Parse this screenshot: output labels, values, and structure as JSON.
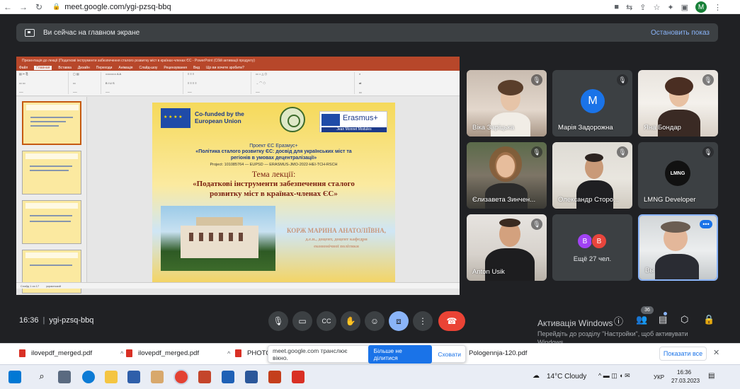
{
  "browser": {
    "url": "meet.google.com/ygi-pzsq-bbq",
    "profile_letter": "M"
  },
  "banner": {
    "text": "Ви сейчас на главном экране",
    "stop_label": "Остановить показ"
  },
  "ppt": {
    "title": "Презентація до лекції (Податкові інструменти забезпечення сталого розвитку міст в країнах-членах ЄС - PowerPoint (Сбій активації продукту)",
    "menu": [
      "Файл",
      "Главная",
      "Вставка",
      "Дизайн",
      "Переходи",
      "Анімація",
      "Слайд-шоу",
      "Рецензування",
      "Вид",
      "Що ви хочете зробити?"
    ],
    "status_left": "Слайд 1 из 17",
    "status_lang": "украинский"
  },
  "slide": {
    "cofunded": "Co-funded by the European Union",
    "erasmus": "Erasmus+",
    "jean_monnet": "Jean Monnet Modules",
    "project": "Проект ЄС Еразмус+",
    "title_line1": "«Політика сталого розвитку ЄС: досвід для українських міст та",
    "title_line2": "регіонів в умовах децентралізації»",
    "project_code": "Project: 101085764 — EUPSD — ERASMUS-JMO-2022-HEI-TCH-RSCH",
    "topic": "Тема лекції:",
    "topic_line1": "«Податкові інструменти забезпечення сталого",
    "topic_line2": "розвитку міст в країнах-членах ЄС»",
    "author_name": "КОРЖ МАРИНА АНАТОЛІЇВНА,",
    "author_title1": "д.е.н.,    доцент,    доцент    кафедри",
    "author_title2": "економічної політики"
  },
  "participants": [
    {
      "name": "Віка Заріцька",
      "muted": true
    },
    {
      "name": "Марія Задорожна",
      "muted": true,
      "avatar": "M",
      "avatar_color": "#1a73e8"
    },
    {
      "name": "Яна Бондар",
      "muted": true
    },
    {
      "name": "Єлизавета Зинчен...",
      "muted": true
    },
    {
      "name": "Олександр Сторо...",
      "muted": true
    },
    {
      "name": "LMNG Developer",
      "muted": true,
      "logo": "LMNG"
    },
    {
      "name": "Anton Usik",
      "muted": true
    },
    {
      "more_label": "Ещё 27 чел.",
      "avatars": [
        "B",
        "B"
      ],
      "avatar_colors": [
        "#a142f4",
        "#e8453c"
      ]
    },
    {
      "name": "Вы",
      "self": true
    }
  ],
  "meeting": {
    "time": "16:36",
    "code": "ygi-pzsq-bbq",
    "people_count": "36"
  },
  "watermark": {
    "title": "Активація Windows",
    "line1": "Перейдіть до розділу \"Настройки\", щоб активувати",
    "line2": "Windows."
  },
  "downloads": {
    "items": [
      "ilovepdf_merged.pdf",
      "ilovepdf_merged.pdf",
      "PHOTO",
      "Pologennja-120.pdf"
    ],
    "share_text": "meet.google.com транслює вікно.",
    "share_stop": "Більше не ділитися",
    "share_hide": "Сховати",
    "show_all": "Показати все"
  },
  "taskbar": {
    "weather": "14°C  Cloudy",
    "lang": "УКР",
    "time": "16:36",
    "date": "27.03.2023"
  },
  "colors": {
    "meet_bg": "#202124",
    "tile_bg": "#3c4043",
    "accent_blue": "#8ab4f8",
    "hangup_red": "#ea4335",
    "ppt_red": "#b7472a"
  }
}
